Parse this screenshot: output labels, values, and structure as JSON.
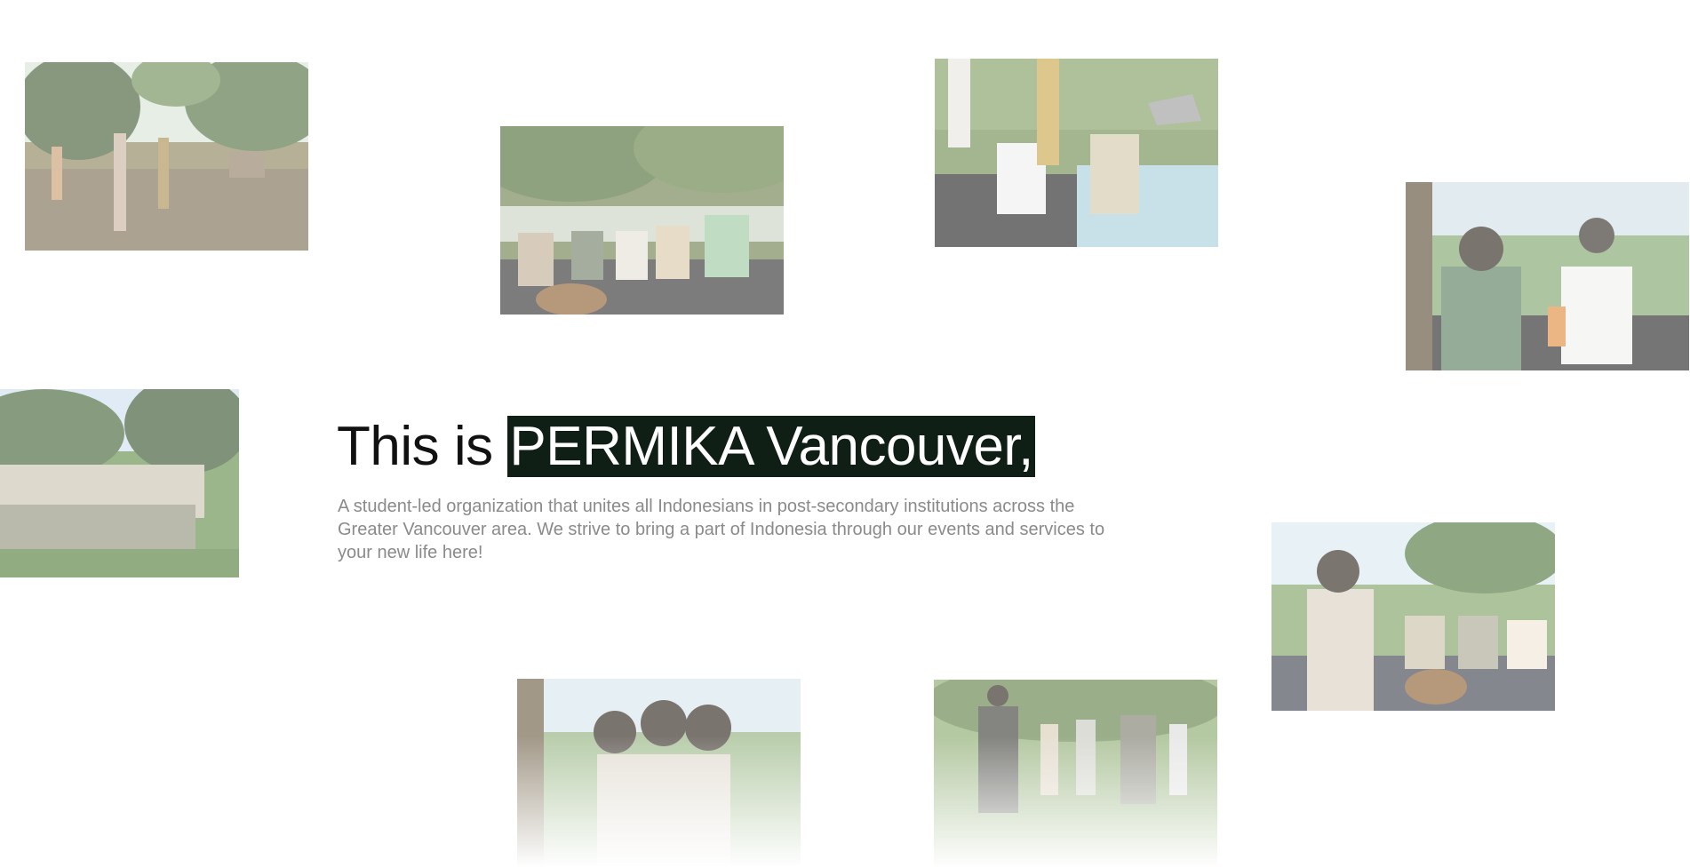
{
  "hero": {
    "prefix": "This is",
    "highlight": "PERMIKA Vancouver,",
    "description": "A student-led organization that unites all Indonesians in post-secondary institutions across the Greater Vancouver area. We strive to bring a part of Indonesia through our events and services to your new life here!"
  },
  "colors": {
    "highlight_background": "#0f1f15",
    "highlight_text": "#ffffff",
    "heading_text": "#111111",
    "description_text": "#8a8a8a"
  }
}
